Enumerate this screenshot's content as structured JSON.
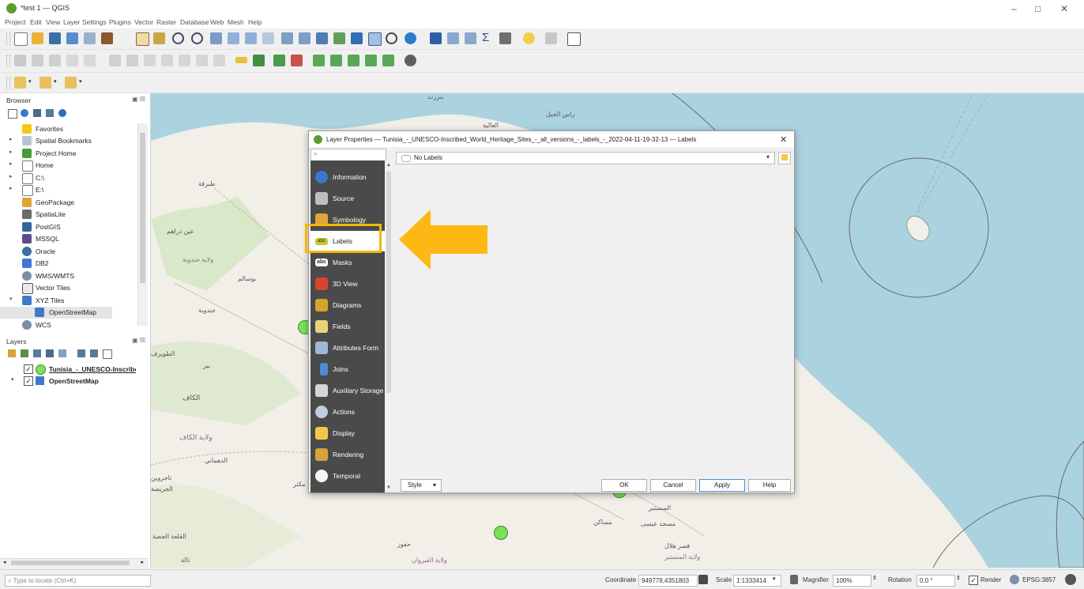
{
  "window": {
    "title": "*test 1 — QGIS",
    "minimize": "–",
    "maximize": "□",
    "close": "✕"
  },
  "menu": [
    "Project",
    "Edit",
    "View",
    "Layer",
    "Settings",
    "Plugins",
    "Vector",
    "Raster",
    "Database",
    "Web",
    "Mesh",
    "Help"
  ],
  "browser": {
    "title": "Browser",
    "items": [
      {
        "label": "Favorites",
        "icon": "star-icon",
        "expand": ""
      },
      {
        "label": "Spatial Bookmarks",
        "icon": "bookmark-icon",
        "expand": "▸"
      },
      {
        "label": "Project Home",
        "icon": "folder-icon",
        "expand": "▸"
      },
      {
        "label": "Home",
        "icon": "home-folder-icon",
        "expand": "▸"
      },
      {
        "label": "C:\\",
        "icon": "drive-icon",
        "expand": "▸"
      },
      {
        "label": "E:\\",
        "icon": "drive-icon",
        "expand": "▸"
      },
      {
        "label": "GeoPackage",
        "icon": "geopackage-icon",
        "expand": ""
      },
      {
        "label": "SpatiaLite",
        "icon": "spatialite-icon",
        "expand": ""
      },
      {
        "label": "PostGIS",
        "icon": "postgis-icon",
        "expand": ""
      },
      {
        "label": "MSSQL",
        "icon": "mssql-icon",
        "expand": ""
      },
      {
        "label": "Oracle",
        "icon": "oracle-icon",
        "expand": ""
      },
      {
        "label": "DB2",
        "icon": "db2-icon",
        "expand": ""
      },
      {
        "label": "WMS/WMTS",
        "icon": "wms-icon",
        "expand": ""
      },
      {
        "label": "Vector Tiles",
        "icon": "vector-tiles-icon",
        "expand": ""
      },
      {
        "label": "XYZ Tiles",
        "icon": "xyz-tiles-icon",
        "expand": "▾"
      },
      {
        "label": "OpenStreetMap",
        "icon": "xyz-tiles-icon",
        "expand": ""
      },
      {
        "label": "WCS",
        "icon": "wcs-icon",
        "expand": ""
      }
    ]
  },
  "layers": {
    "title": "Layers",
    "items": [
      {
        "label": "Tunisia_-_UNESCO-Inscribed_Wo",
        "checked": "✓"
      },
      {
        "label": "OpenStreetMap",
        "checked": "✓"
      }
    ]
  },
  "dialog": {
    "title": "Layer Properties — Tunisia_-_UNESCO-Inscribed_World_Heritage_Sites_-_all_versions_-_labels_-_2022-04-11-19-32-13 — Labels",
    "close": "✕",
    "search_icon": "🔍",
    "nav": [
      "Information",
      "Source",
      "Symbology",
      "Labels",
      "Masks",
      "3D View",
      "Diagrams",
      "Fields",
      "Attributes Form",
      "Joins",
      "Auxiliary Storage",
      "Actions",
      "Display",
      "Rendering",
      "Temporal"
    ],
    "labels_mode": "No Labels",
    "style_label": "Style",
    "ok": "OK",
    "cancel": "Cancel",
    "apply": "Apply",
    "help": "Help",
    "abc_badge": "abc"
  },
  "map_labels": [
    "بنزرت",
    "راس الجبل",
    "العالية",
    "طبرقة",
    "عين دراهم",
    "ولاية جندوبة",
    "بوسالم",
    "جندوبة",
    "الطويرف",
    "بير",
    "الكاف",
    "ولاية الكاف",
    "الدهماني",
    "تاجروين",
    "الجريصة",
    "مكثر",
    "القلعة الجصة",
    "تالة",
    "ولاية القيروان",
    "حفوز",
    "المنستير",
    "مساكن",
    "مسجد عيسى",
    "قصر هلال",
    "ولاية المنستير"
  ],
  "status": {
    "locator_placeholder": "Type to locate (Ctrl+K)",
    "coordinate_label": "Coordinate",
    "coordinate": "949778,4351803",
    "scale_label": "Scale",
    "scale": "1:1333414",
    "magnifier_label": "Magnifier",
    "magnifier": "100%",
    "rotation_label": "Rotation",
    "rotation": "0.0 °",
    "render_label": "Render",
    "crs": "EPSG:3857"
  },
  "colors": {
    "highlight": "#f5b800",
    "arrow": "#fdb813",
    "sea": "#aad3df",
    "land": "#f2efe9",
    "nav_bg": "#4a4a4a",
    "point": "#7be05a"
  }
}
